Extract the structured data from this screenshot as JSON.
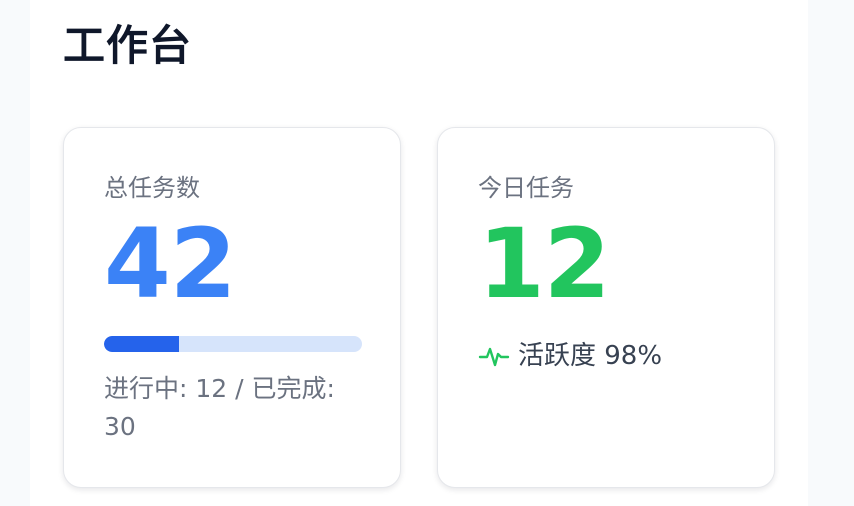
{
  "page": {
    "title": "工作台"
  },
  "cards": {
    "total": {
      "label": "总任务数",
      "value": "42",
      "progress": {
        "fraction_complete": 0.29,
        "caption": "进行中: 12 / 已完成: 30"
      }
    },
    "today": {
      "label": "今日任务",
      "value": "12",
      "activity": {
        "icon": "activity-pulse-icon",
        "text": "活跃度 98%"
      }
    }
  },
  "colors": {
    "total_value": "#3b82f6",
    "today_value": "#22c55e",
    "progress_fill": "#2563eb",
    "progress_track": "#d6e4fb",
    "activity_icon": "#22c55e"
  }
}
